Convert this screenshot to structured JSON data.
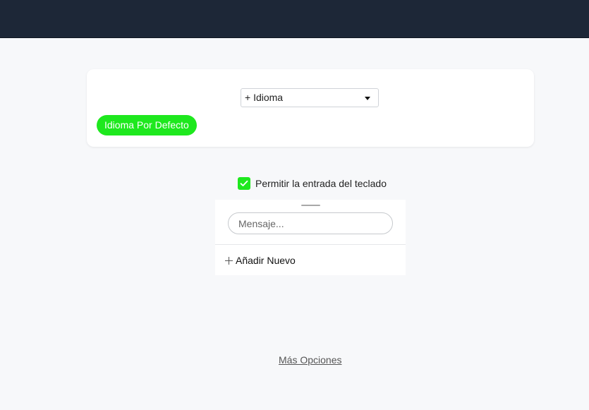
{
  "language_card": {
    "select_value": "+ Idioma",
    "default_language_label": "Idioma Por Defecto",
    "accent_color": "#1ee81e"
  },
  "keyboard": {
    "checkbox_checked": true,
    "label": "Permitir la entrada del teclado"
  },
  "message_panel": {
    "input_placeholder": "Mensaje...",
    "input_value": "",
    "add_new_label": "Añadir Nuevo"
  },
  "footer": {
    "more_options_label": "Más Opciones"
  },
  "colors": {
    "topbar": "#1d2737",
    "background": "#f7f8fa"
  }
}
